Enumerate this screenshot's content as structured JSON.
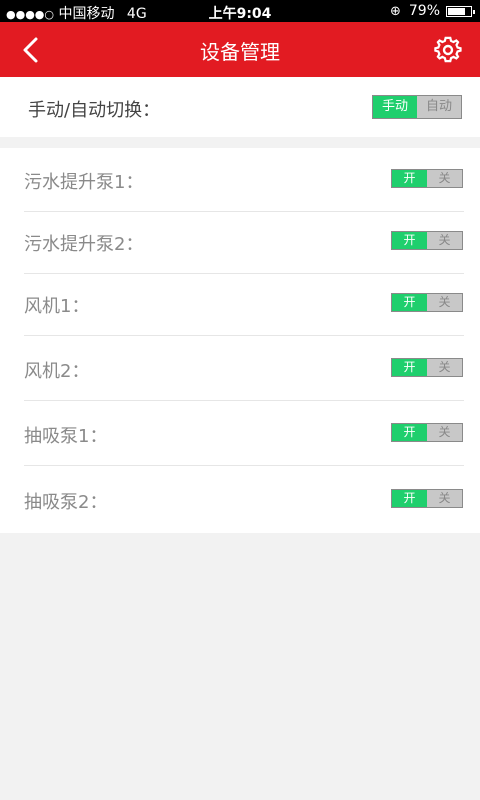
{
  "status_bar": {
    "signal_dots": "●●●●○",
    "carrier": "中国移动",
    "network": "4G",
    "time": "上午9:04",
    "battery_percent_label": "79%",
    "battery_level": 0.79
  },
  "nav": {
    "title": "设备管理",
    "back_icon": "chevron-left-icon",
    "settings_icon": "gear-icon",
    "accent_color": "#e21b22"
  },
  "mode": {
    "label": "手动/自动切换：",
    "option_manual": "手动",
    "option_auto": "自动",
    "selected": "手动"
  },
  "devices": [
    {
      "name": "污水提升泵1：",
      "on_label": "开",
      "off_label": "关",
      "state": "开"
    },
    {
      "name": "污水提升泵2：",
      "on_label": "开",
      "off_label": "关",
      "state": "开"
    },
    {
      "name": "风机1：",
      "on_label": "开",
      "off_label": "关",
      "state": "开"
    },
    {
      "name": "风机2：",
      "on_label": "开",
      "off_label": "关",
      "state": "开"
    },
    {
      "name": "抽吸泵1：",
      "on_label": "开",
      "off_label": "关",
      "state": "开"
    },
    {
      "name": "抽吸泵2：",
      "on_label": "开",
      "off_label": "关",
      "state": "开"
    }
  ],
  "colors": {
    "toggle_on": "#1fcf6d",
    "toggle_off": "#c8c8c8"
  }
}
